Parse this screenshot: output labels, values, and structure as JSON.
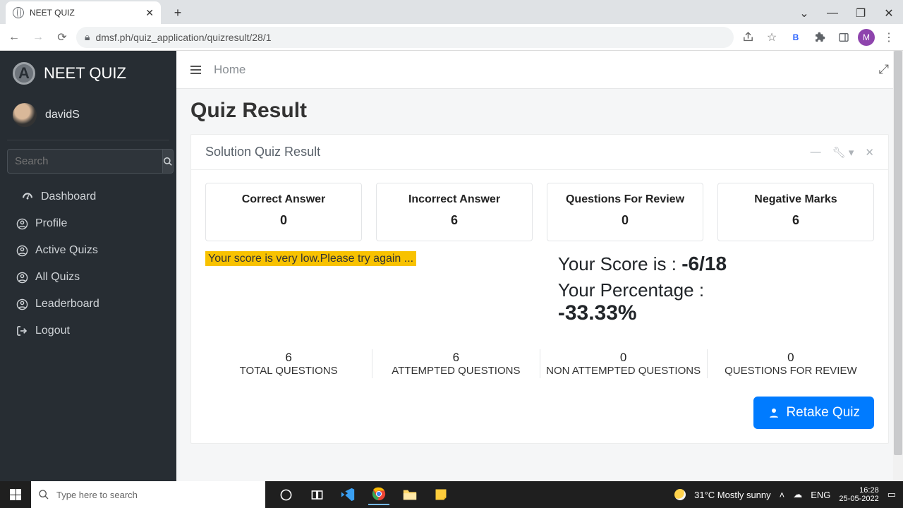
{
  "browser": {
    "tab_title": "NEET QUIZ",
    "url": "dmsf.ph/quiz_application/quizresult/28/1",
    "avatar_letter": "M",
    "ext_letter": "B"
  },
  "sidebar": {
    "brand": "NEET QUIZ",
    "brand_logo_letter": "A",
    "username": "davidS",
    "search_placeholder": "Search",
    "items": [
      {
        "label": "Dashboard",
        "icon": "dashboard-icon"
      },
      {
        "label": "Profile",
        "icon": "user-icon"
      },
      {
        "label": "Active Quizs",
        "icon": "user-icon"
      },
      {
        "label": "All Quizs",
        "icon": "user-icon"
      },
      {
        "label": "Leaderboard",
        "icon": "user-icon"
      },
      {
        "label": "Logout",
        "icon": "logout-icon"
      }
    ]
  },
  "topbar": {
    "crumb": "Home"
  },
  "page": {
    "title": "Quiz Result",
    "panel_title": "Solution Quiz Result",
    "warning": "Your score is very low.Please try again ...",
    "score_label": "Your Score is : ",
    "score_value": "-6/18",
    "pct_label": "Your Percentage : ",
    "pct_value": "-33.33%",
    "retake_label": "Retake Quiz"
  },
  "stats": [
    {
      "label": "Correct Answer",
      "value": "0"
    },
    {
      "label": "Incorrect Answer",
      "value": "6"
    },
    {
      "label": "Questions For Review",
      "value": "0"
    },
    {
      "label": "Negative Marks",
      "value": "6"
    }
  ],
  "summary": [
    {
      "value": "6",
      "label": "TOTAL QUESTIONS"
    },
    {
      "value": "6",
      "label": "ATTEMPTED QUESTIONS"
    },
    {
      "value": "0",
      "label": "NON ATTEMPTED QUESTIONS"
    },
    {
      "value": "0",
      "label": "QUESTIONS FOR REVIEW"
    }
  ],
  "taskbar": {
    "search_placeholder": "Type here to search",
    "weather": "31°C  Mostly sunny",
    "lang": "ENG",
    "time": "16:28",
    "date": "25-05-2022"
  }
}
